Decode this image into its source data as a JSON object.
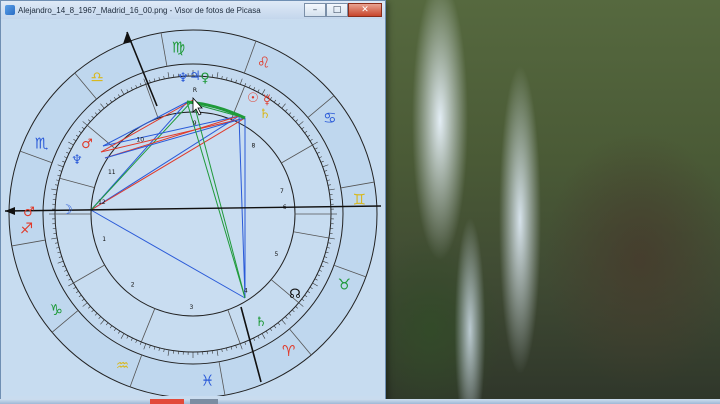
{
  "window": {
    "title": "Alejandro_14_8_1967_Madrid_16_00.png - Visor de fotos de Picasa",
    "minimize_glyph": "–",
    "maximize_glyph": "□",
    "close_glyph": "✕"
  },
  "chart": {
    "zodiac_signs": [
      {
        "glyph": "♍",
        "color": "#1f9a3a",
        "angle": 95
      },
      {
        "glyph": "♌",
        "color": "#e03a2a",
        "angle": 65
      },
      {
        "glyph": "♋",
        "color": "#2a5ad8",
        "angle": 35
      },
      {
        "glyph": "♊",
        "color": "#d8b81e",
        "angle": 5
      },
      {
        "glyph": "♉",
        "color": "#1f9a3a",
        "angle": -25
      },
      {
        "glyph": "♈",
        "color": "#e03a2a",
        "angle": -55
      },
      {
        "glyph": "♓",
        "color": "#2a5ad8",
        "angle": -85
      },
      {
        "glyph": "♒",
        "color": "#d8b81e",
        "angle": -115
      },
      {
        "glyph": "♑",
        "color": "#1f9a3a",
        "angle": -145
      },
      {
        "glyph": "♐",
        "color": "#e03a2a",
        "angle": -175
      },
      {
        "glyph": "♏",
        "color": "#2a5ad8",
        "angle": 155
      },
      {
        "glyph": "♎",
        "color": "#d8b81e",
        "angle": 125
      }
    ],
    "house_numbers": [
      "1",
      "2",
      "3",
      "4",
      "5",
      "6",
      "7",
      "8",
      "9",
      "10",
      "11",
      "12"
    ],
    "planets": [
      {
        "glyph": "♆",
        "color": "#2a5ad8"
      },
      {
        "glyph": "♃",
        "color": "#2a5ad8"
      },
      {
        "glyph": "♀",
        "color": "#1f9a3a"
      },
      {
        "glyph": "☉",
        "color": "#e03a2a"
      },
      {
        "glyph": "☿",
        "color": "#e03a2a"
      },
      {
        "glyph": "♄",
        "color": "#d8b81e"
      },
      {
        "glyph": "♂",
        "color": "#e03a2a"
      },
      {
        "glyph": "♆",
        "color": "#2a5ad8"
      },
      {
        "glyph": "☽",
        "color": "#2a5ad8"
      },
      {
        "glyph": "♂",
        "color": "#e03a2a"
      },
      {
        "glyph": "♄",
        "color": "#1f9a3a"
      },
      {
        "glyph": "☊",
        "color": "#111111"
      }
    ],
    "retro_mark": "R"
  }
}
